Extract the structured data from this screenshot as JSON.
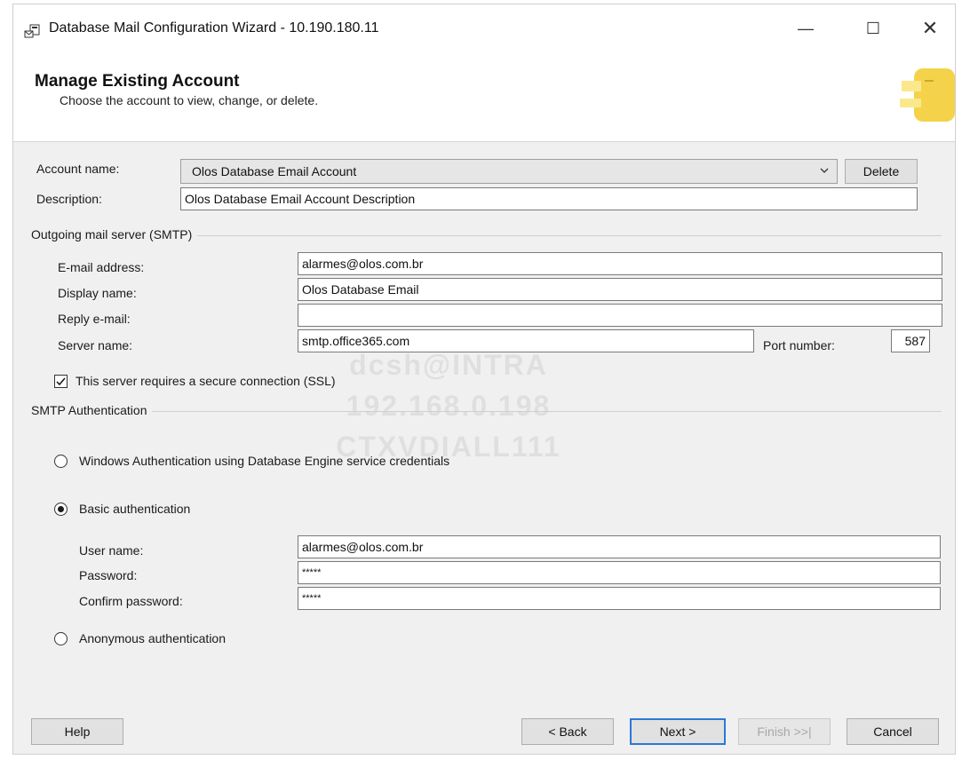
{
  "window": {
    "title": "Database Mail Configuration Wizard - 10.190.180.11",
    "min_glyph": "—",
    "max_glyph": "☐",
    "close_glyph": "✕"
  },
  "header": {
    "title": "Manage Existing Account",
    "subtitle": "Choose the account to view, change, or delete."
  },
  "account": {
    "name_label": "Account name:",
    "name_value": "Olos Database Email Account",
    "delete_label": "Delete",
    "description_label": "Description:",
    "description_value": "Olos Database Email Account Description"
  },
  "smtp": {
    "group_title": "Outgoing mail server (SMTP)",
    "email_label": "E-mail address:",
    "email_value": "alarmes@olos.com.br",
    "display_label": "Display name:",
    "display_value": "Olos Database Email",
    "reply_label": "Reply e-mail:",
    "reply_value": "",
    "server_label": "Server name:",
    "server_value": "smtp.office365.com",
    "port_label": "Port number:",
    "port_value": "587",
    "ssl_label": "This server requires a secure connection (SSL)",
    "ssl_checked": true
  },
  "auth": {
    "group_title": "SMTP Authentication",
    "windows_label": "Windows Authentication using Database Engine service credentials",
    "basic_label": "Basic authentication",
    "selected": "basic",
    "user_label": "User name:",
    "user_value": "alarmes@olos.com.br",
    "password_label": "Password:",
    "password_value": "*****",
    "confirm_label": "Confirm password:",
    "confirm_value": "*****",
    "anonymous_label": "Anonymous authentication"
  },
  "watermark": [
    "dcsh@INTRA",
    "192.168.0.198",
    "CTXVDIALL111"
  ],
  "footer": {
    "help": "Help",
    "back": "< Back",
    "next": "Next >",
    "finish": "Finish >>|",
    "cancel": "Cancel"
  },
  "colors": {
    "accent": "#2b79d6",
    "banner": "#f4d34a"
  },
  "icons": [
    "app-icon",
    "minimize-icon",
    "maximize-icon",
    "close-icon",
    "chevron-down-icon",
    "checkmark-icon",
    "wizard-banner-icon"
  ]
}
